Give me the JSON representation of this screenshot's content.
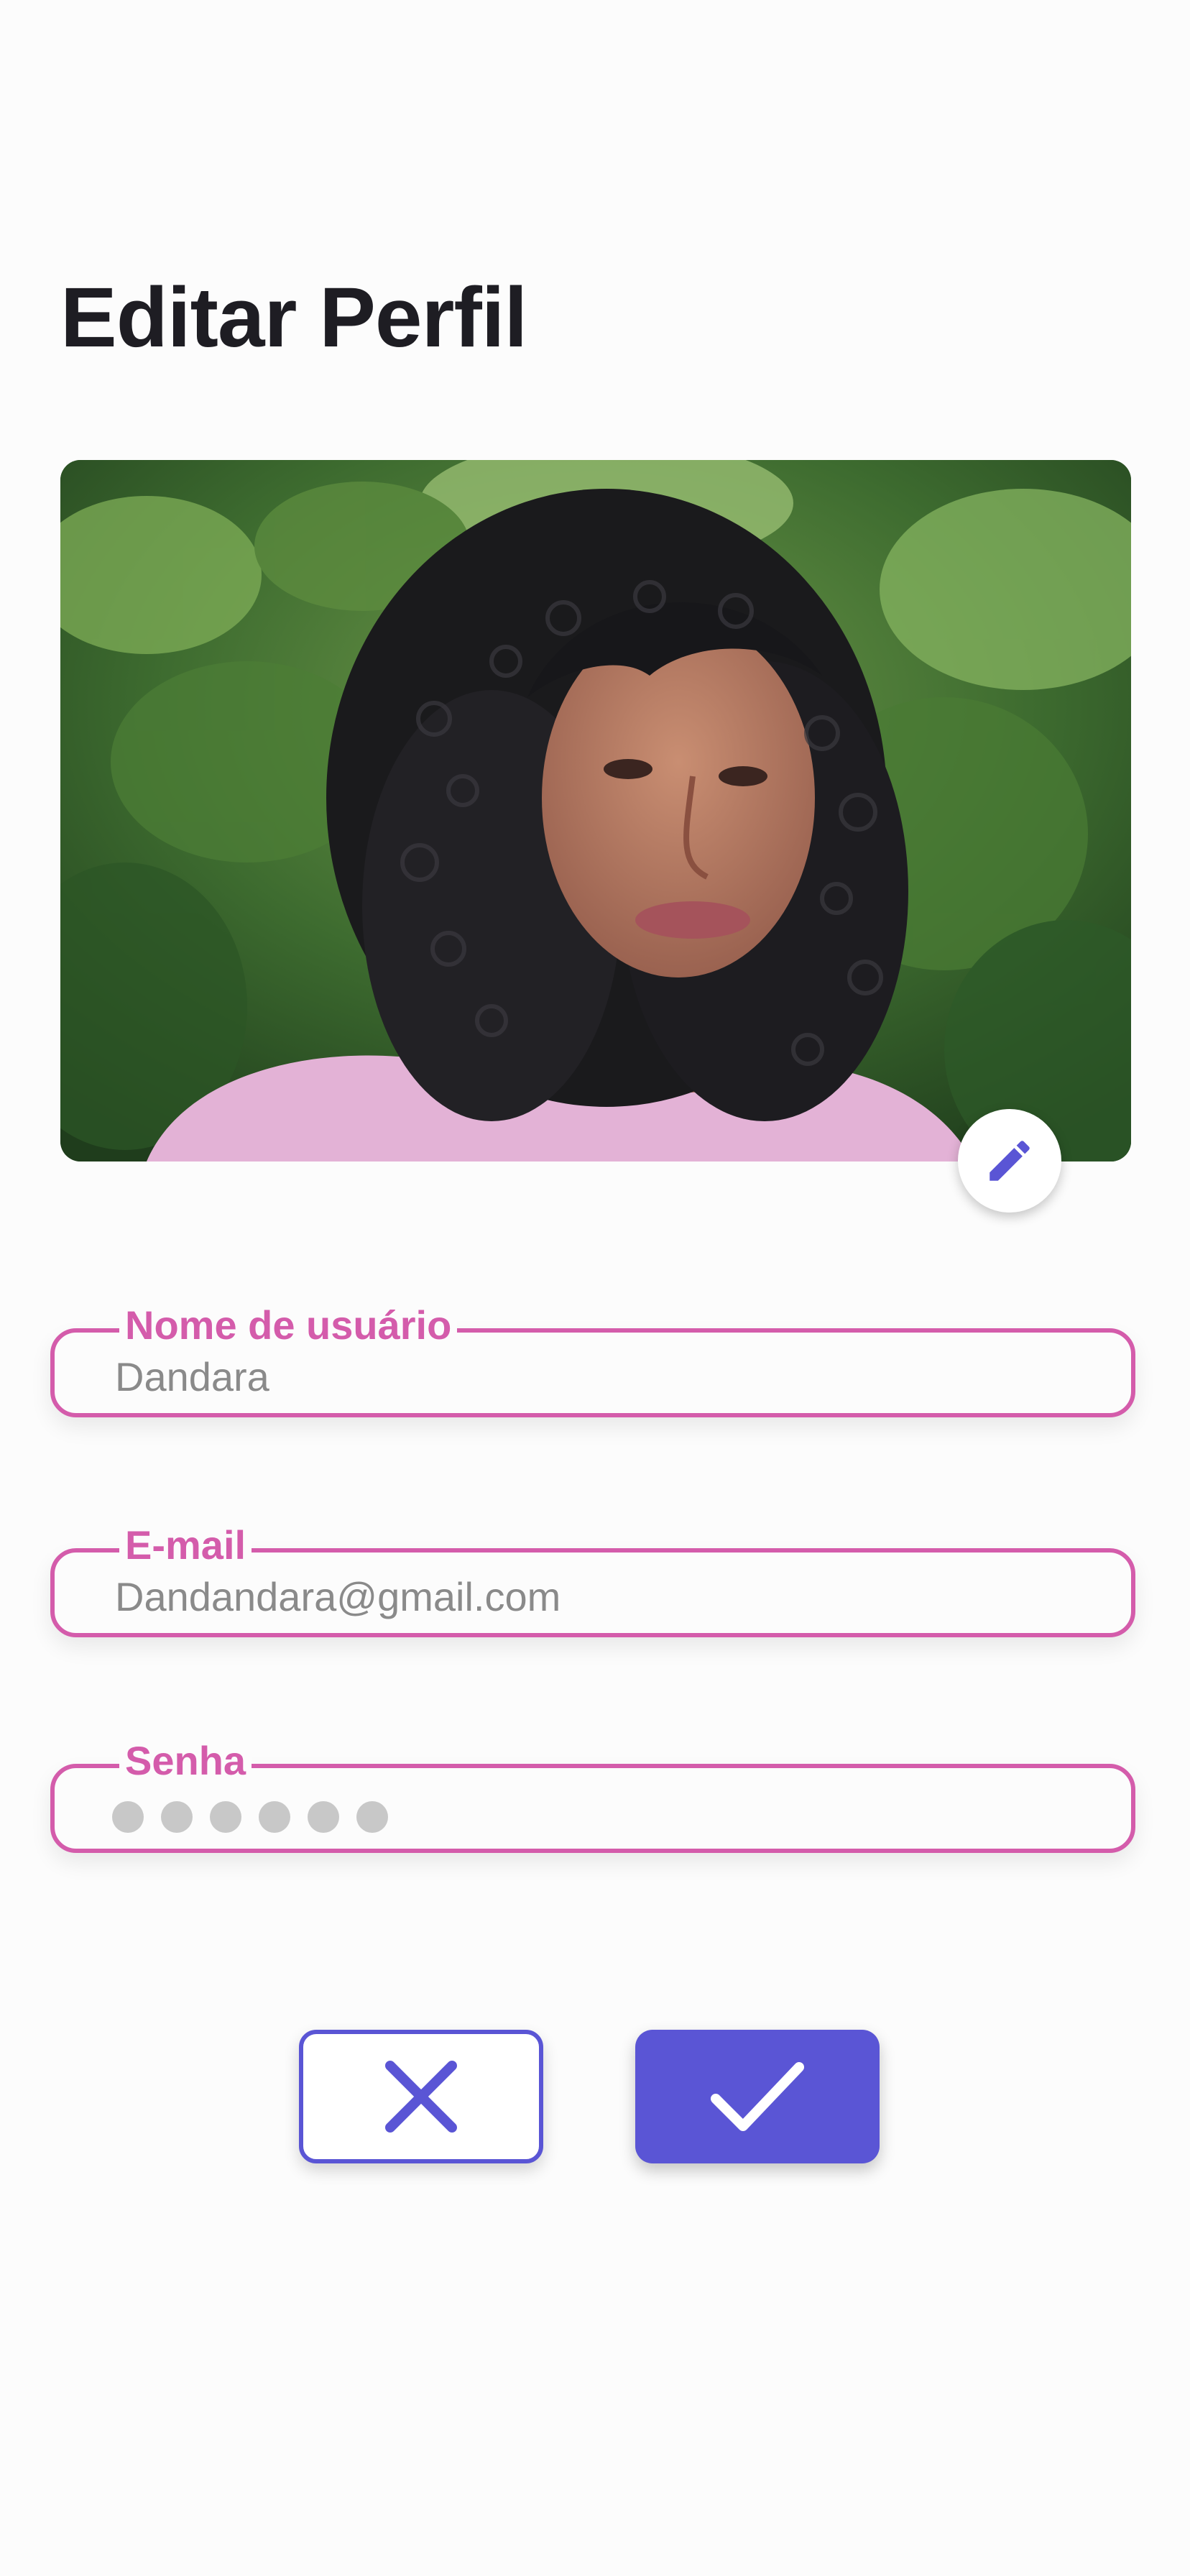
{
  "page": {
    "title": "Editar Perfil"
  },
  "profile_photo": {
    "description_icon": "profile-photo",
    "edit_icon": "pencil-icon"
  },
  "form": {
    "username": {
      "label": "Nome de usuário",
      "value": "Dandara"
    },
    "email": {
      "label": "E-mail",
      "value": "Dandandara@gmail.com"
    },
    "password": {
      "label": "Senha",
      "masked_length": 6
    }
  },
  "actions": {
    "cancel_icon": "close-icon",
    "confirm_icon": "check-icon"
  },
  "colors": {
    "accent_pink": "#d45cab",
    "accent_purple": "#5a55d5",
    "title_text": "#1e1d23",
    "value_text": "#8a8a8a",
    "background": "#fcfcfc"
  }
}
